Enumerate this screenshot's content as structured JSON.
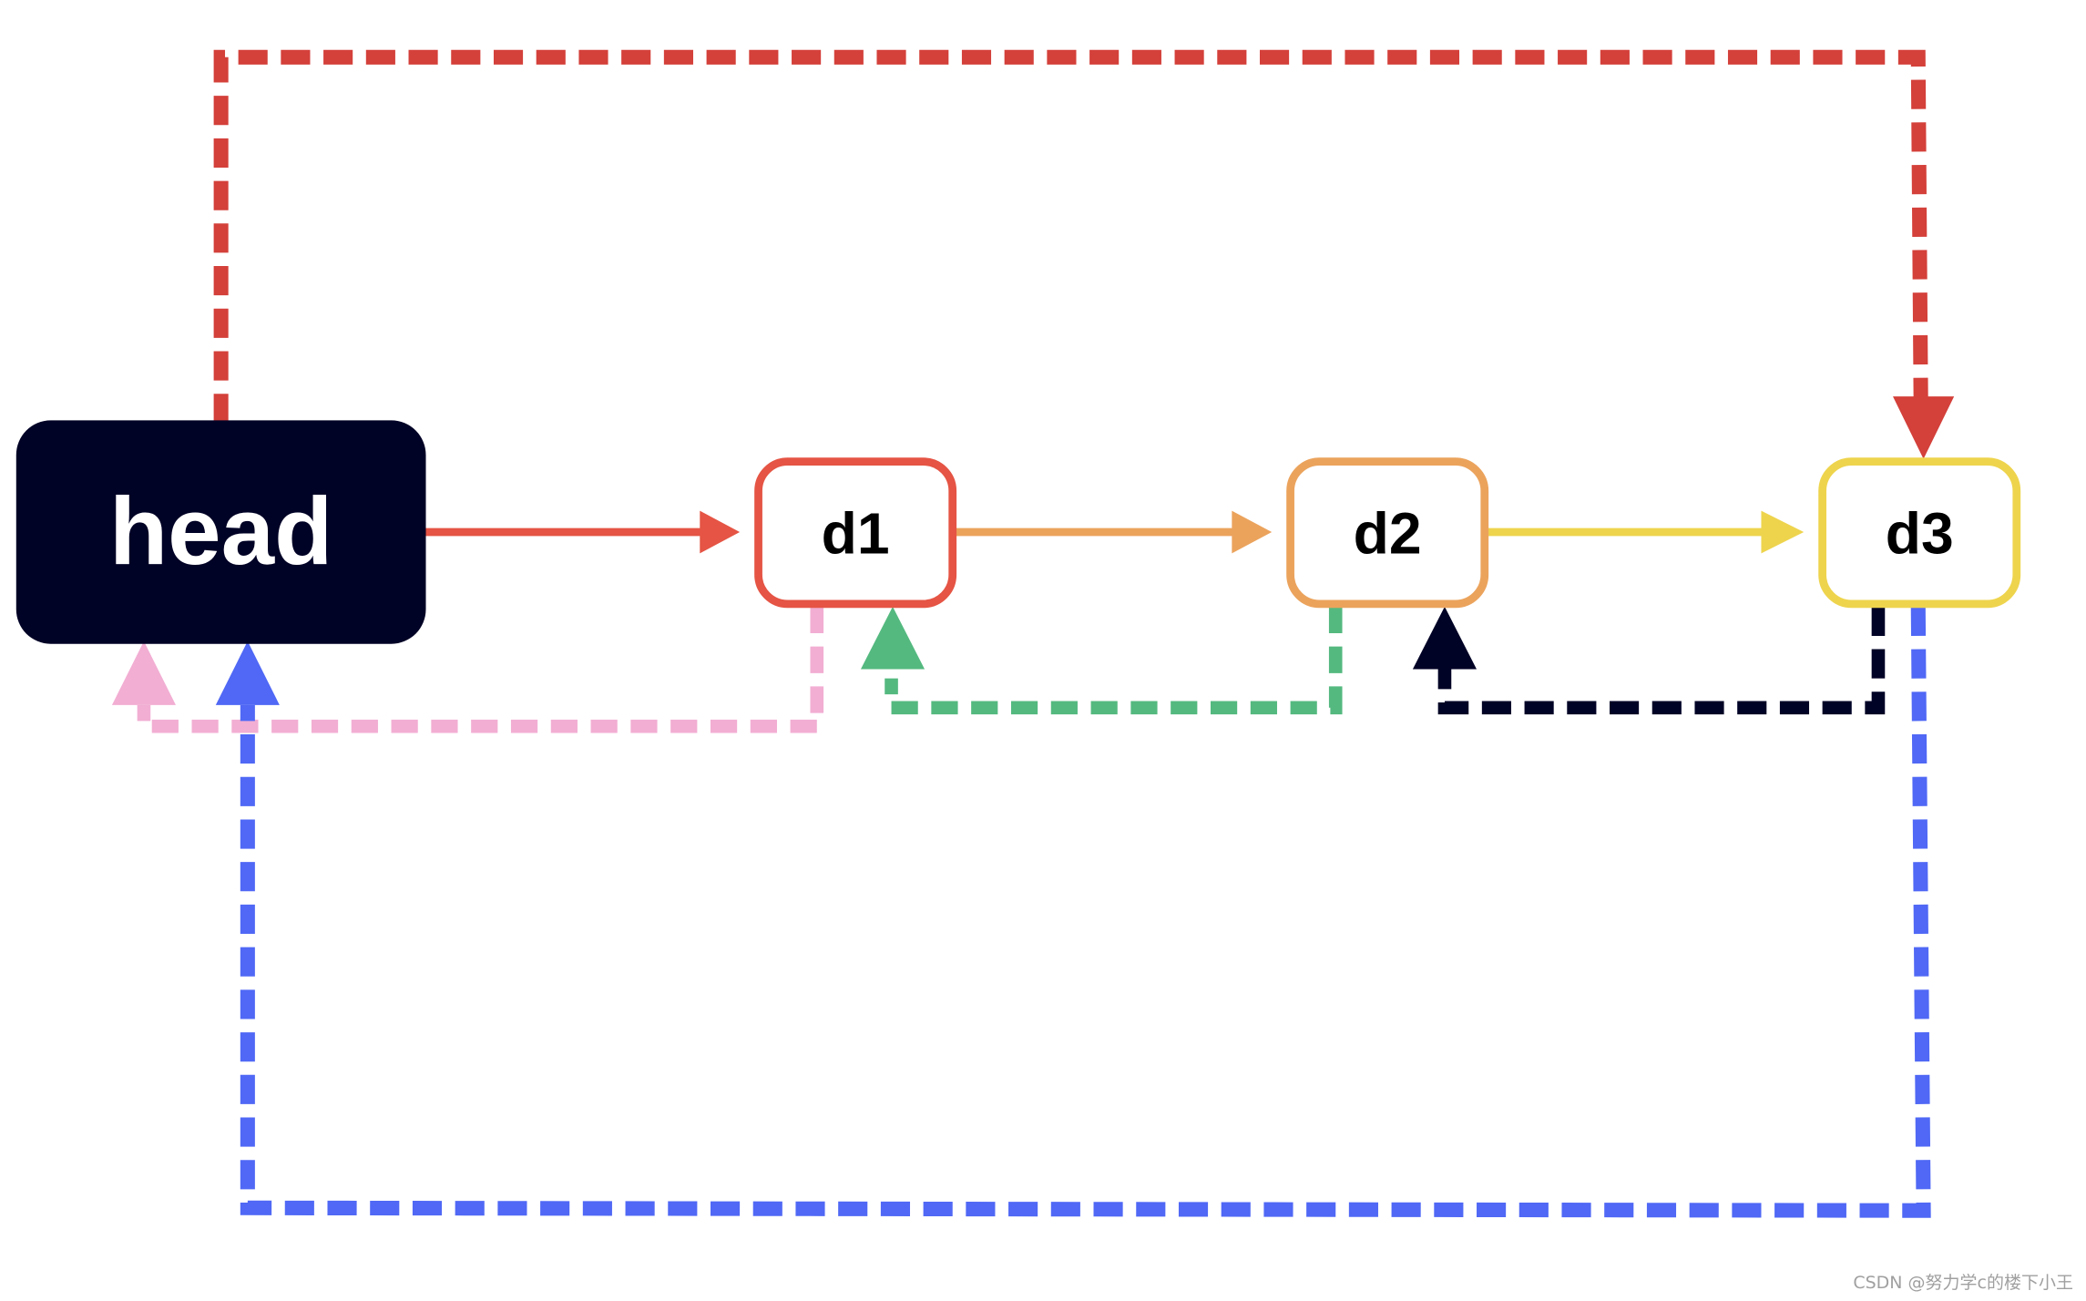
{
  "diagram": {
    "type": "doubly-linked circular list",
    "nodes": [
      {
        "id": "head",
        "label": "head",
        "fill": "#000226",
        "border": "#000226",
        "text_color": "#ffffff"
      },
      {
        "id": "d1",
        "label": "d1",
        "fill": "#ffffff",
        "border": "#e55444",
        "text_color": "#000000"
      },
      {
        "id": "d2",
        "label": "d2",
        "fill": "#ffffff",
        "border": "#eba35c",
        "text_color": "#000000"
      },
      {
        "id": "d3",
        "label": "d3",
        "fill": "#ffffff",
        "border": "#eed44d",
        "text_color": "#000000"
      }
    ],
    "edges": [
      {
        "from": "head",
        "to": "d1",
        "style": "solid",
        "color": "#e55444",
        "meaning": "next"
      },
      {
        "from": "d1",
        "to": "d2",
        "style": "solid",
        "color": "#eba35c",
        "meaning": "next"
      },
      {
        "from": "d2",
        "to": "d3",
        "style": "solid",
        "color": "#eed44d",
        "meaning": "next"
      },
      {
        "from": "head",
        "to": "d3",
        "style": "dashed",
        "color": "#d4403a",
        "meaning": "prev"
      },
      {
        "from": "d1",
        "to": "head",
        "style": "dashed",
        "color": "#f2aed3",
        "meaning": "prev"
      },
      {
        "from": "d2",
        "to": "d1",
        "style": "dashed",
        "color": "#54b97f",
        "meaning": "prev"
      },
      {
        "from": "d3",
        "to": "d2",
        "style": "dashed",
        "color": "#000226",
        "meaning": "prev"
      },
      {
        "from": "d3",
        "to": "head",
        "style": "dashed",
        "color": "#5068f5",
        "meaning": "next"
      }
    ]
  },
  "watermark": "CSDN @努力学c的楼下小王"
}
